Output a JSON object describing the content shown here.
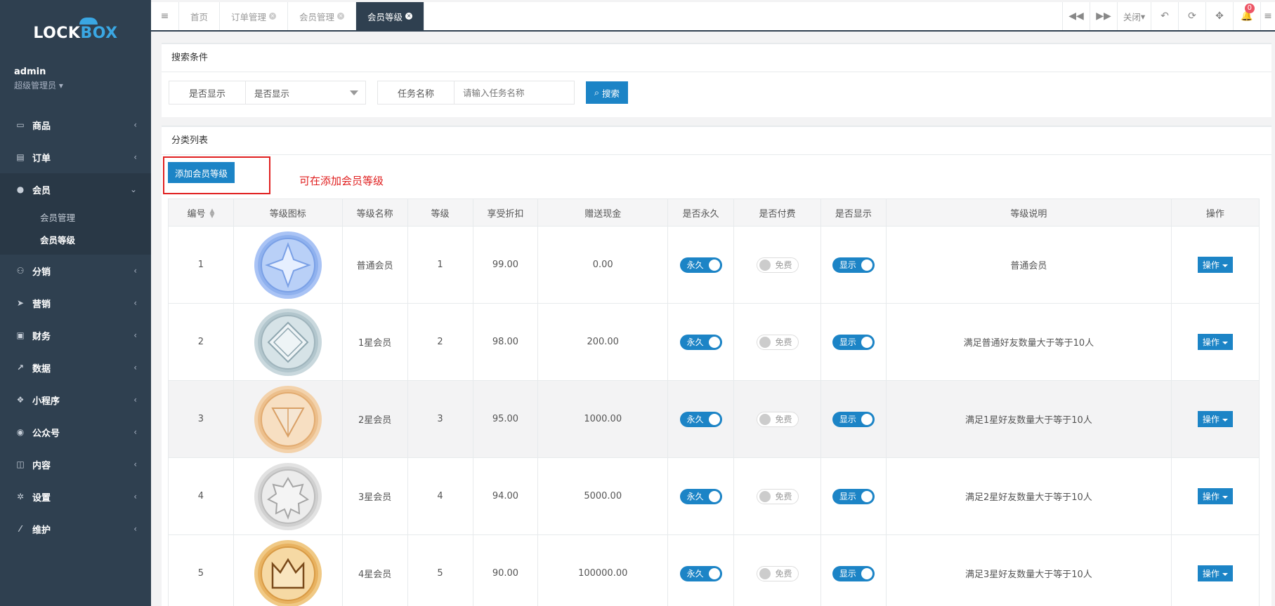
{
  "sidebar": {
    "logo_main": "LOCK",
    "logo_accent": "BOX",
    "user_name": "admin",
    "user_role": "超级管理员",
    "items": [
      {
        "label": "商品",
        "icon": "laptop-icon"
      },
      {
        "label": "订单",
        "icon": "file-icon"
      },
      {
        "label": "会员",
        "icon": "user-icon",
        "active": true,
        "children": [
          {
            "label": "会员管理"
          },
          {
            "label": "会员等级",
            "active": true
          }
        ]
      },
      {
        "label": "分销",
        "icon": "users-icon"
      },
      {
        "label": "营销",
        "icon": "send-icon"
      },
      {
        "label": "财务",
        "icon": "money-icon"
      },
      {
        "label": "数据",
        "icon": "chart-icon"
      },
      {
        "label": "小程序",
        "icon": "cubes-icon"
      },
      {
        "label": "公众号",
        "icon": "wechat-icon"
      },
      {
        "label": "内容",
        "icon": "book-icon"
      },
      {
        "label": "设置",
        "icon": "gear-icon"
      },
      {
        "label": "维护",
        "icon": "wand-icon"
      }
    ]
  },
  "topbar": {
    "tabs": [
      {
        "label": "首页"
      },
      {
        "label": "订单管理"
      },
      {
        "label": "会员管理"
      },
      {
        "label": "会员等级",
        "active": true
      }
    ],
    "close_label": "关闭",
    "notif_count": "0"
  },
  "search": {
    "title": "搜索条件",
    "show_label": "是否显示",
    "show_value": "是否显示",
    "task_label": "任务名称",
    "task_placeholder": "请输入任务名称",
    "search_button": "搜索"
  },
  "list": {
    "title": "分类列表",
    "add_button": "添加会员等级",
    "note": "可在添加会员等级",
    "columns": [
      "编号",
      "等级图标",
      "等级名称",
      "等级",
      "享受折扣",
      "赠送现金",
      "是否永久",
      "是否付费",
      "是否显示",
      "等级说明",
      "操作"
    ],
    "rows": [
      {
        "id": "1",
        "name": "普通会员",
        "level": "1",
        "discount": "99.00",
        "cash": "0.00",
        "permanent": "永久",
        "paid": "免费",
        "show": "显示",
        "desc": "普通会员",
        "op": "操作"
      },
      {
        "id": "2",
        "name": "1星会员",
        "level": "2",
        "discount": "98.00",
        "cash": "200.00",
        "permanent": "永久",
        "paid": "免费",
        "show": "显示",
        "desc": "满足普通好友数量大于等于10人",
        "op": "操作"
      },
      {
        "id": "3",
        "name": "2星会员",
        "level": "3",
        "discount": "95.00",
        "cash": "1000.00",
        "permanent": "永久",
        "paid": "免费",
        "show": "显示",
        "desc": "满足1星好友数量大于等于10人",
        "op": "操作"
      },
      {
        "id": "4",
        "name": "3星会员",
        "level": "4",
        "discount": "94.00",
        "cash": "5000.00",
        "permanent": "永久",
        "paid": "免费",
        "show": "显示",
        "desc": "满足2星好友数量大于等于10人",
        "op": "操作"
      },
      {
        "id": "5",
        "name": "4星会员",
        "level": "5",
        "discount": "90.00",
        "cash": "100000.00",
        "permanent": "永久",
        "paid": "免费",
        "show": "显示",
        "desc": "满足3星好友数量大于等于10人",
        "op": "操作"
      }
    ]
  },
  "colors": {
    "sidebar_bg": "#2f4050",
    "accent_blue": "#1c84c6",
    "highlight_red": "#e02020"
  }
}
